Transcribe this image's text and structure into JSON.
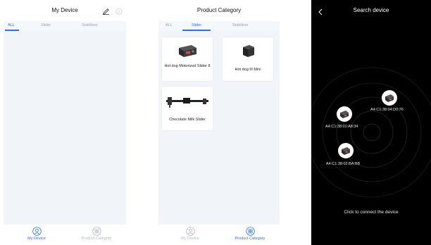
{
  "screen1": {
    "title": "My Device",
    "tabs": [
      {
        "label": "ALL",
        "active": true
      },
      {
        "label": "Slider",
        "active": false
      },
      {
        "label": "Stabilizer",
        "active": false
      }
    ],
    "nav": [
      {
        "label": "My Device",
        "icon": "user-icon",
        "active": true
      },
      {
        "label": "Product Category",
        "icon": "category-icon",
        "active": false
      }
    ]
  },
  "screen2": {
    "title": "Product Category",
    "tabs": [
      {
        "label": "ALL",
        "active": false
      },
      {
        "label": "Slider",
        "active": true
      },
      {
        "label": "Stabilizer",
        "active": false
      }
    ],
    "products": [
      {
        "name": "Hot dog Motorized Slider II",
        "icon": "motorized-slider-icon"
      },
      {
        "name": "Hot dog III Mini",
        "icon": "mini-slider-icon"
      },
      {
        "name": "Chocolate Milk Slider",
        "icon": "rail-slider-icon"
      }
    ],
    "nav": [
      {
        "label": "My Device",
        "icon": "user-icon",
        "active": false
      },
      {
        "label": "Product Category",
        "icon": "category-icon",
        "active": true
      }
    ]
  },
  "screen3": {
    "title": "Search device",
    "devices": [
      {
        "address": "A4:C1:38:04:D0:76"
      },
      {
        "address": "A4:C1:38:01:A8:34"
      },
      {
        "address": "A4:C1:38:02:BA:BB"
      }
    ],
    "hint": "Click to connect the device"
  },
  "colors": {
    "accent": "#2f6fde",
    "inactive": "#b3b8bf",
    "content_bg": "#f1f5fa",
    "search_bg": "#000000"
  }
}
